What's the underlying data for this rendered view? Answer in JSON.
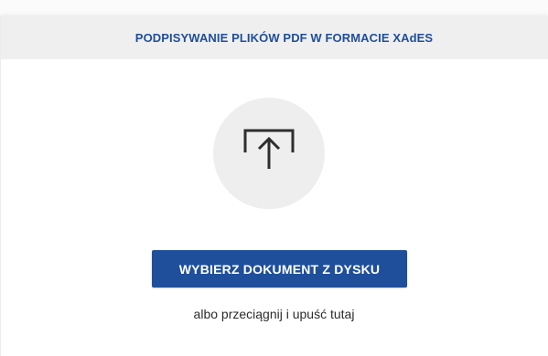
{
  "header": {
    "title": "PODPISYWANIE PLIKÓW PDF W FORMACIE XAdES"
  },
  "upload": {
    "icon": "upload-tray-arrow-icon",
    "button_label": "WYBIERZ DOKUMENT Z DYSKU",
    "drop_hint": "albo przeciągnij i upuść tutaj"
  },
  "colors": {
    "accent": "#1f4f9b",
    "header_background": "#efefef",
    "icon_circle": "#eeeeee"
  }
}
